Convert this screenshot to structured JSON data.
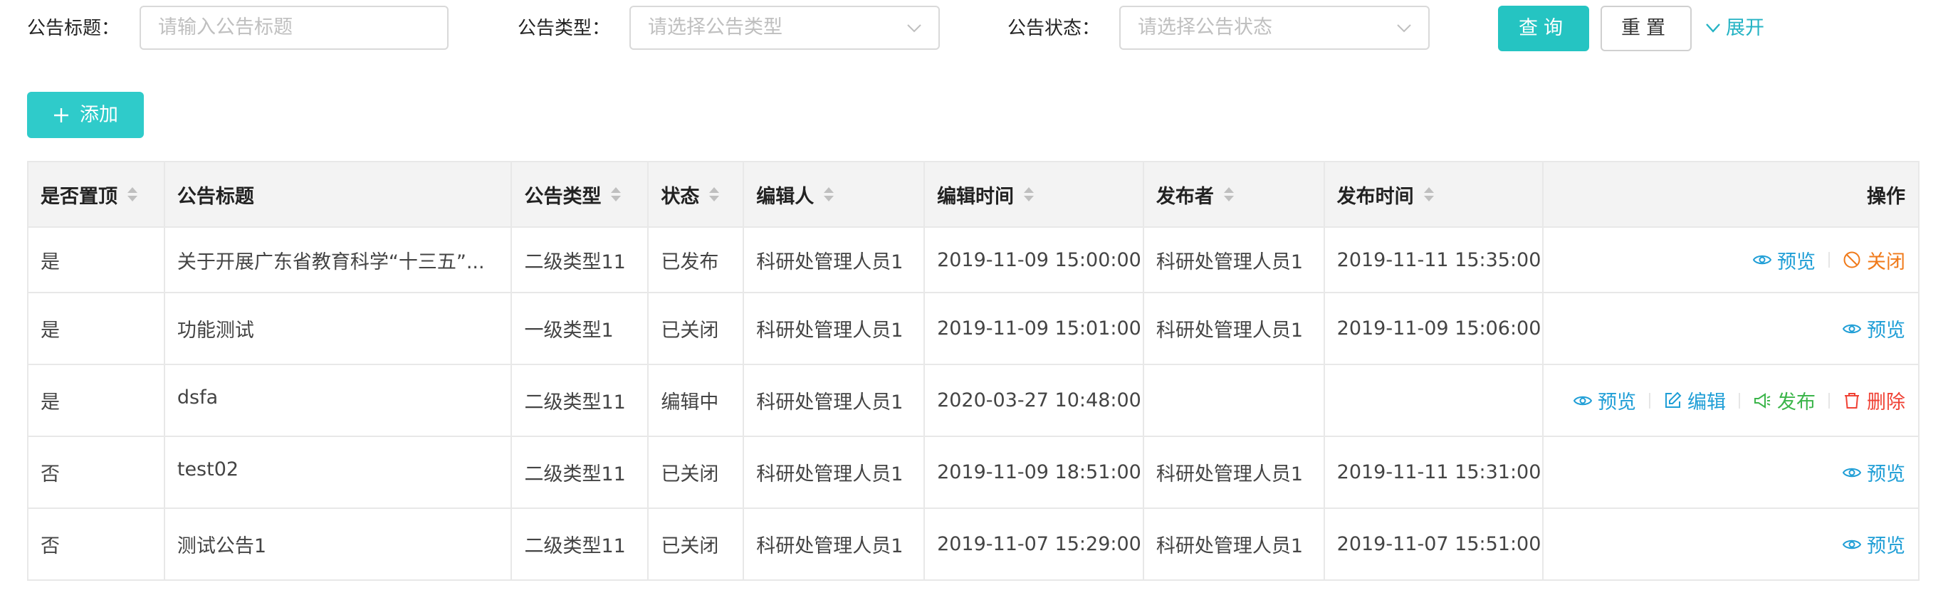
{
  "filters": {
    "title_label": "公告标题：",
    "title_placeholder": "请输入公告标题",
    "type_label": "公告类型：",
    "type_placeholder": "请选择公告类型",
    "status_label": "公告状态：",
    "status_placeholder": "请选择公告状态",
    "query_label": "查询",
    "reset_label": "重置",
    "expand_label": "展开"
  },
  "toolbar": {
    "add_label": "添加"
  },
  "table": {
    "headers": [
      "是否置顶",
      "公告标题",
      "公告类型",
      "状态",
      "编辑人",
      "编辑时间",
      "发布者",
      "发布时间",
      "操作"
    ],
    "rows": [
      {
        "pinned": "是",
        "title": "关于开展广东省教育科学“十三五”...",
        "type": "二级类型11",
        "status": "已发布",
        "status_kind": "published",
        "editor": "科研处管理人员1",
        "edit_time": "2019-11-09 15:00:00",
        "publisher": "科研处管理人员1",
        "publish_time": "2019-11-11 15:35:00",
        "actions": [
          "预览",
          "关闭"
        ]
      },
      {
        "pinned": "是",
        "title": "功能测试",
        "type": "一级类型1",
        "status": "已关闭",
        "status_kind": "closed",
        "editor": "科研处管理人员1",
        "edit_time": "2019-11-09 15:01:00",
        "publisher": "科研处管理人员1",
        "publish_time": "2019-11-09 15:06:00",
        "actions": [
          "预览"
        ]
      },
      {
        "pinned": "是",
        "title": "dsfa",
        "type": "二级类型11",
        "status": "编辑中",
        "status_kind": "editing",
        "editor": "科研处管理人员1",
        "edit_time": "2020-03-27 10:48:00",
        "publisher": "",
        "publish_time": "",
        "actions": [
          "预览",
          "编辑",
          "发布",
          "删除"
        ]
      },
      {
        "pinned": "否",
        "title": "test02",
        "type": "二级类型11",
        "status": "已关闭",
        "status_kind": "closed",
        "editor": "科研处管理人员1",
        "edit_time": "2019-11-09 18:51:00",
        "publisher": "科研处管理人员1",
        "publish_time": "2019-11-11 15:31:00",
        "actions": [
          "预览"
        ]
      },
      {
        "pinned": "否",
        "title": "测试公告1",
        "type": "二级类型11",
        "status": "已关闭",
        "status_kind": "closed",
        "editor": "科研处管理人员1",
        "edit_time": "2019-11-07 15:29:00",
        "publisher": "科研处管理人员1",
        "publish_time": "2019-11-07 15:51:00",
        "actions": [
          "预览"
        ]
      }
    ]
  },
  "colors": {
    "primary": "#25c4c2",
    "link": "#1f9ed6",
    "published": "#3bb54a",
    "closed": "#a0a0a0",
    "editing": "#f04134",
    "close_action": "#f07a1a"
  },
  "icons": {
    "expand": "chevron-down-icon",
    "add": "plus-icon",
    "preview": "eye-icon",
    "close": "ban-icon",
    "edit": "edit-icon",
    "publish": "megaphone-icon",
    "delete": "trash-icon"
  }
}
